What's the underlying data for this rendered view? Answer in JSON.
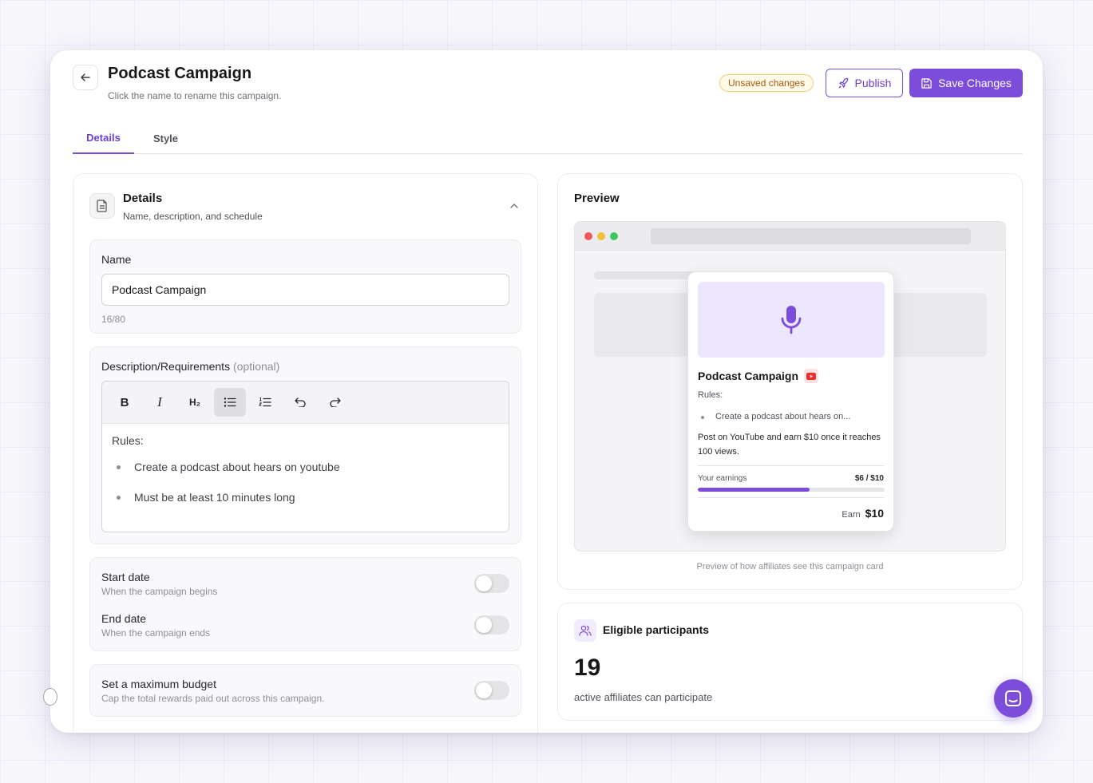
{
  "header": {
    "title": "Podcast Campaign",
    "subtitle": "Click the name to rename this campaign.",
    "unsaved_badge": "Unsaved changes",
    "publish_label": "Publish",
    "save_label": "Save Changes"
  },
  "tabs": [
    {
      "label": "Details",
      "active": true
    },
    {
      "label": "Style",
      "active": false
    }
  ],
  "details": {
    "title": "Details",
    "subtitle": "Name, description, and schedule",
    "name_label": "Name",
    "name_value": "Podcast Campaign",
    "char_count": "16/80",
    "description_label": "Description/Requirements",
    "optional_label": "(optional)",
    "toolbar": [
      {
        "icon": "bold-icon",
        "label": "B"
      },
      {
        "icon": "italic-icon",
        "label": "I"
      },
      {
        "icon": "heading-icon",
        "label": "H₂"
      },
      {
        "icon": "bullet-list-icon",
        "label": "",
        "active": true
      },
      {
        "icon": "numbered-list-icon",
        "label": ""
      },
      {
        "icon": "undo-icon",
        "label": ""
      },
      {
        "icon": "redo-icon",
        "label": ""
      }
    ],
    "editor": {
      "heading": "Rules:",
      "bullets": [
        "Create a podcast about hears on youtube",
        "Must be at least 10 minutes long"
      ]
    },
    "start_date": {
      "title": "Start date",
      "subtitle": "When the campaign begins",
      "enabled": false
    },
    "end_date": {
      "title": "End date",
      "subtitle": "When the campaign ends",
      "enabled": false
    },
    "budget": {
      "title": "Set a maximum budget",
      "subtitle": "Cap the total rewards paid out across this campaign.",
      "enabled": false
    }
  },
  "preview": {
    "title": "Preview",
    "card": {
      "title": "Podcast Campaign",
      "rules_label": "Rules:",
      "bullet": "Create a podcast about hears on...",
      "description": "Post on YouTube and earn $10 once it reaches 100 views.",
      "earnings_label": "Your earnings",
      "earnings_value": "$6 / $10",
      "progress": 0.6,
      "earn_label": "Earn",
      "earn_amount": "$10"
    },
    "caption": "Preview of how affiliates see this campaign card"
  },
  "eligible": {
    "title": "Eligible participants",
    "count": "19",
    "subtitle": "active affiliates can participate"
  },
  "colors": {
    "accent": "#7c4ddb",
    "badge_text": "#b45309",
    "youtube_red": "#ef2b2b"
  }
}
